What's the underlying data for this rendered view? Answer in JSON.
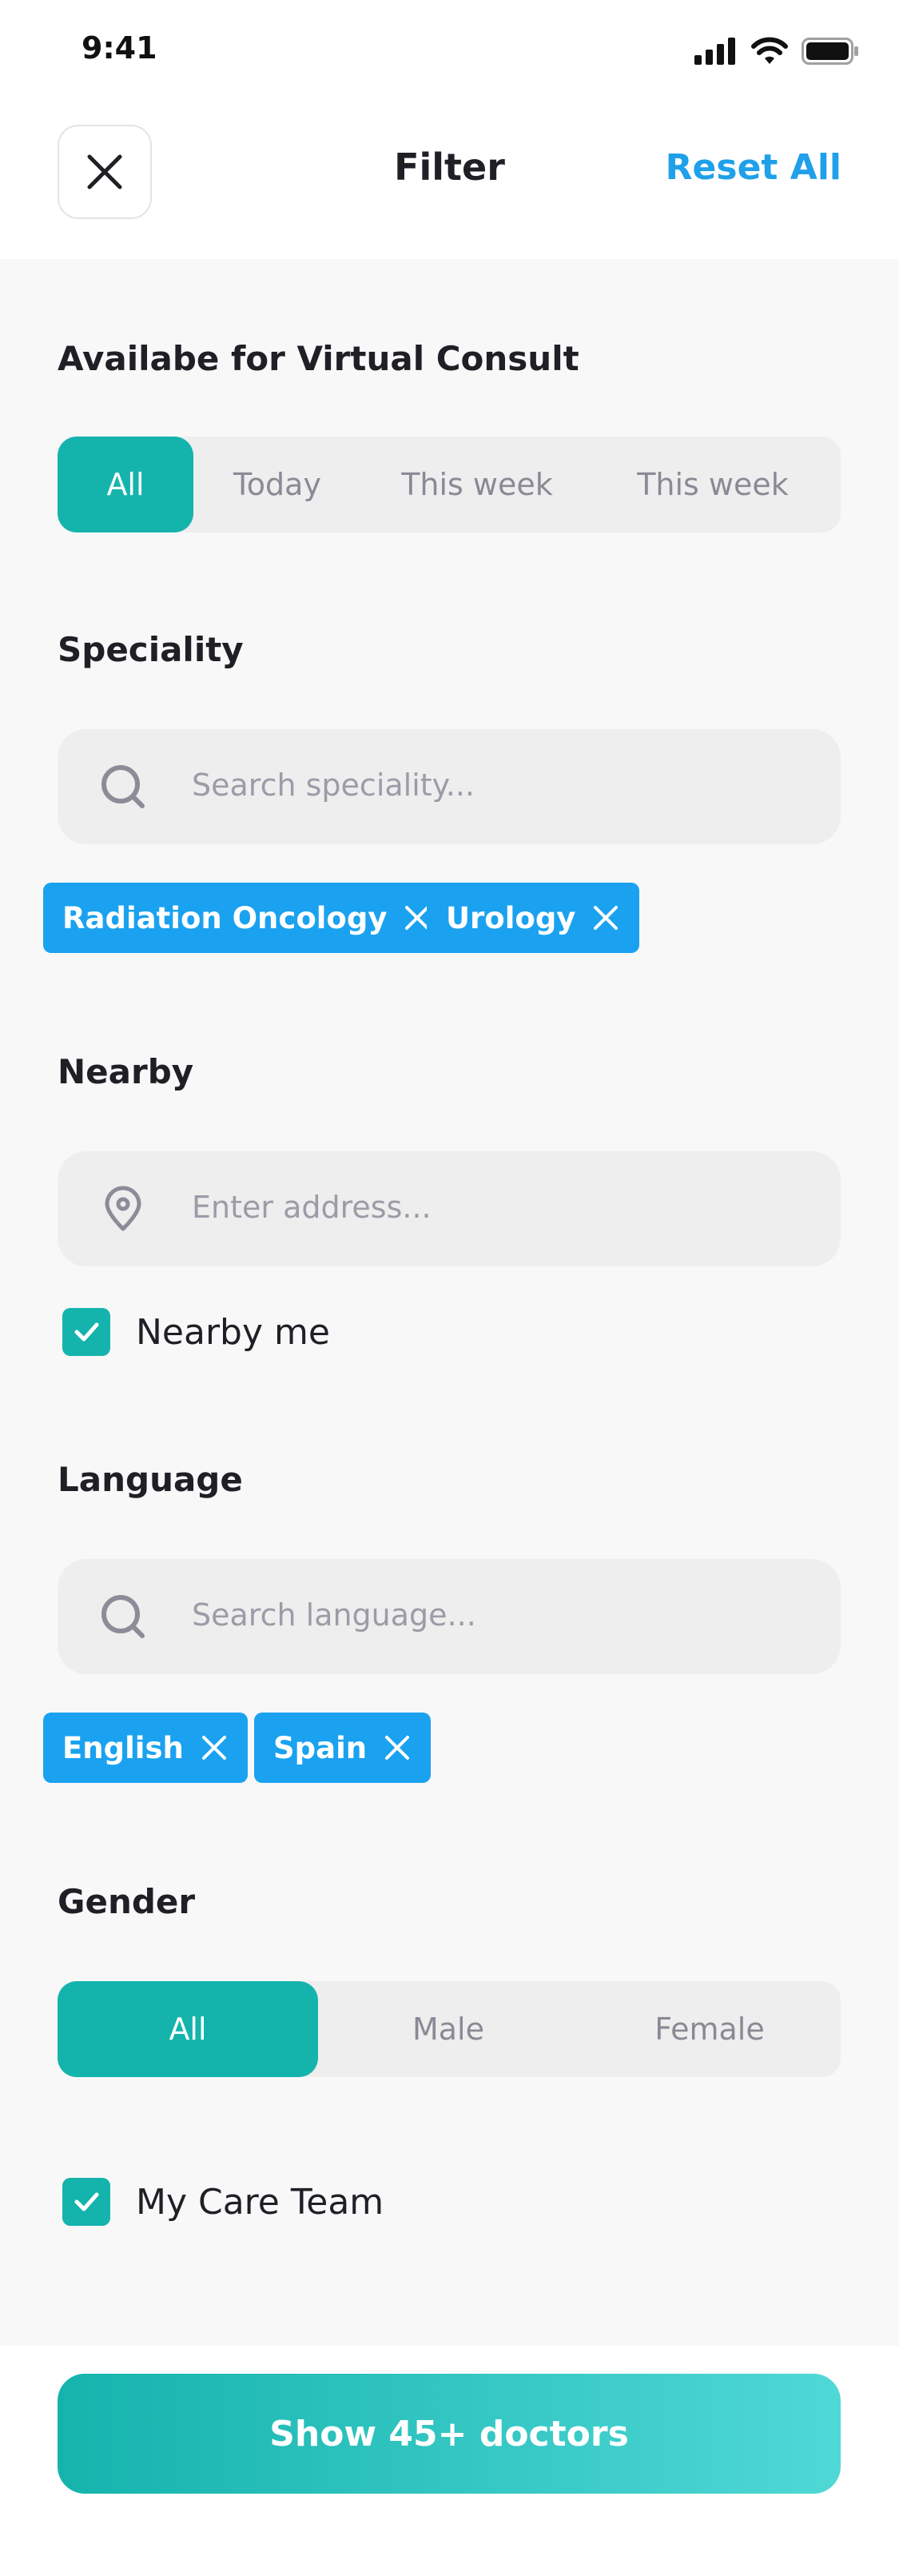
{
  "status_bar": {
    "time": "9:41"
  },
  "header": {
    "title": "Filter",
    "reset_label": "Reset All"
  },
  "virtual_consult": {
    "title": "Availabe for Virtual Consult",
    "options": [
      "All",
      "Today",
      "This week",
      "This week"
    ],
    "selected": "All"
  },
  "speciality": {
    "title": "Speciality",
    "placeholder": "Search speciality...",
    "chips": [
      "Radiation Oncology",
      "Urology"
    ]
  },
  "nearby": {
    "title": "Nearby",
    "placeholder": "Enter address...",
    "checkbox_label": "Nearby me",
    "checked": true
  },
  "language": {
    "title": "Language",
    "placeholder": "Search language...",
    "chips": [
      "English",
      "Spain"
    ]
  },
  "gender": {
    "title": "Gender",
    "options": [
      "All",
      "Male",
      "Female"
    ],
    "selected": "All"
  },
  "care_team": {
    "label": "My Care Team",
    "checked": true
  },
  "footer": {
    "button_label": "Show 45+ doctors"
  },
  "colors": {
    "accent": "#14b4ad",
    "chip": "#1aa2f0",
    "link": "#1fa0e9"
  }
}
